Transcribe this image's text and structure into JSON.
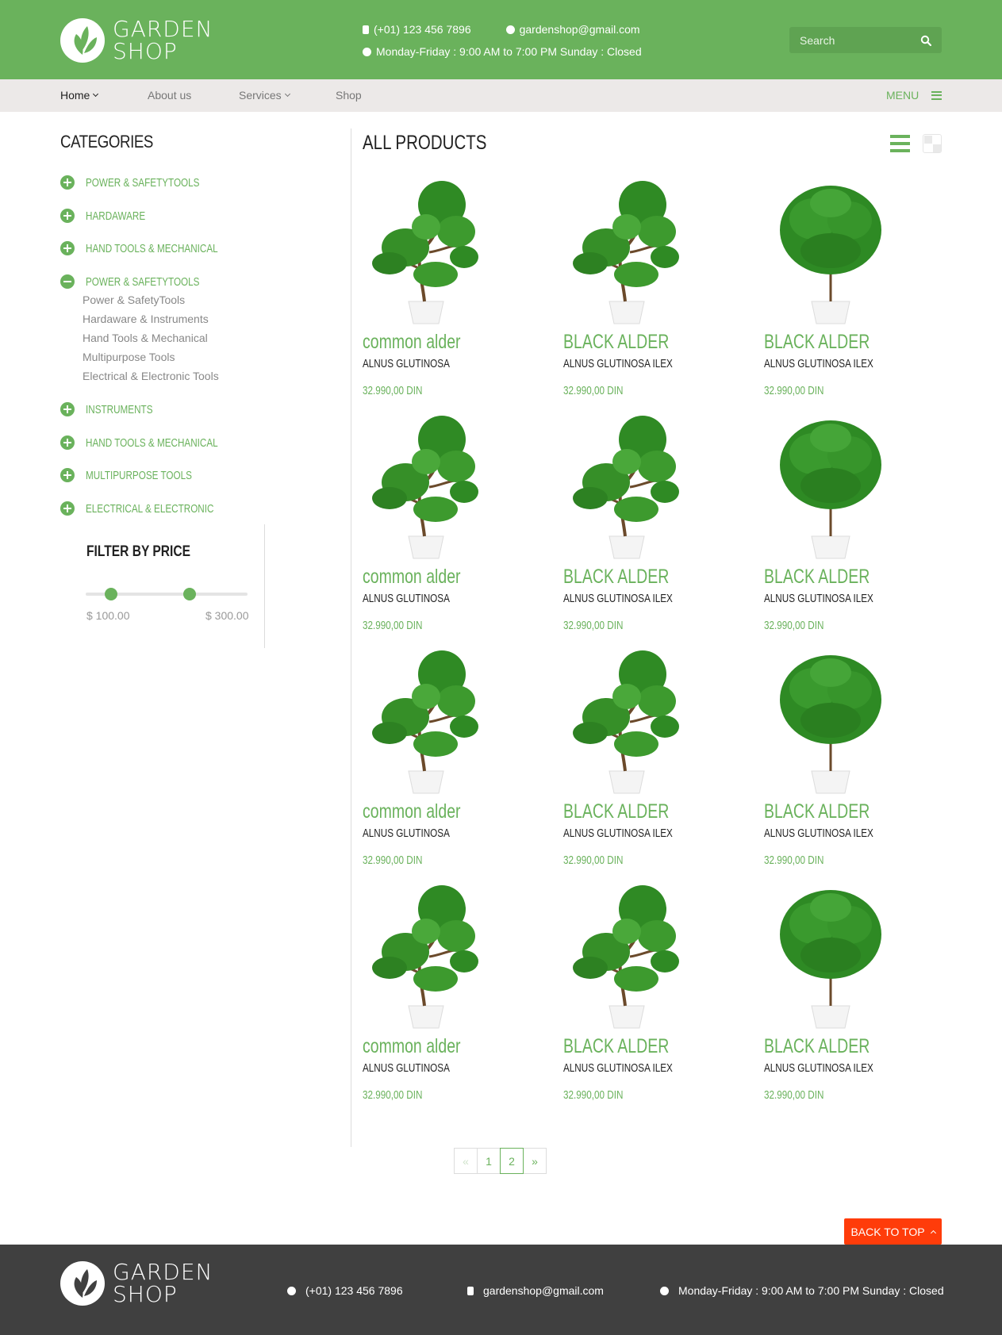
{
  "header": {
    "logo_line1": "GARDEN",
    "logo_line2": "SHOP",
    "phone": "(+01) 123 456 7896",
    "email": "gardenshop@gmail.com",
    "hours": "Monday-Friday : 9:00 AM to 7:00 PM Sunday : Closed",
    "search_placeholder": "Search"
  },
  "nav": {
    "items": [
      {
        "label": "Home"
      },
      {
        "label": "About us"
      },
      {
        "label": "Services"
      },
      {
        "label": "Shop"
      }
    ],
    "menu_label": "MENU"
  },
  "sidebar": {
    "title": "CATEGORIES",
    "categories": [
      {
        "label": "POWER & SAFETYTOOLS",
        "expanded": false
      },
      {
        "label": "HARDAWARE",
        "expanded": false
      },
      {
        "label": "HAND TOOLS & MECHANICAL",
        "expanded": false
      },
      {
        "label": "POWER & SAFETYTOOLS",
        "expanded": true
      },
      {
        "label": "INSTRUMENTS",
        "expanded": false
      },
      {
        "label": "HAND TOOLS & MECHANICAL",
        "expanded": false
      },
      {
        "label": "MULTIPURPOSE TOOLS",
        "expanded": false
      },
      {
        "label": "ELECTRICAL & ELECTRONIC",
        "expanded": false
      }
    ],
    "subcategories": [
      "Power & SafetyTools",
      "Hardaware & Instruments",
      "Hand Tools & Mechanical",
      "Multipurpose Tools",
      "Electrical & Electronic Tools"
    ],
    "filter": {
      "title": "FILTER BY PRICE",
      "min_label": "$ 100.00",
      "max_label": "$ 300.00"
    }
  },
  "main": {
    "title": "ALL PRODUCTS",
    "products": [
      {
        "name": "common alder",
        "sub": "ALNUS GLUTINOSA",
        "price": "32.990,00 DIN",
        "plant": "pine"
      },
      {
        "name": "BLACK ALDER",
        "sub": "ALNUS GLUTINOSA ILEX",
        "price": "32.990,00 DIN",
        "plant": "pine"
      },
      {
        "name": "BLACK ALDER",
        "sub": "ALNUS GLUTINOSA ILEX",
        "price": "32.990,00 DIN",
        "plant": "bush"
      },
      {
        "name": "common alder",
        "sub": "ALNUS GLUTINOSA",
        "price": "32.990,00 DIN",
        "plant": "pine"
      },
      {
        "name": "BLACK ALDER",
        "sub": "ALNUS GLUTINOSA ILEX",
        "price": "32.990,00 DIN",
        "plant": "pine"
      },
      {
        "name": "BLACK ALDER",
        "sub": "ALNUS GLUTINOSA ILEX",
        "price": "32.990,00 DIN",
        "plant": "bush"
      },
      {
        "name": "common alder",
        "sub": "ALNUS GLUTINOSA",
        "price": "32.990,00 DIN",
        "plant": "pine"
      },
      {
        "name": "BLACK ALDER",
        "sub": "ALNUS GLUTINOSA ILEX",
        "price": "32.990,00 DIN",
        "plant": "pine"
      },
      {
        "name": "BLACK ALDER",
        "sub": "ALNUS GLUTINOSA ILEX",
        "price": "32.990,00 DIN",
        "plant": "bush"
      },
      {
        "name": "common alder",
        "sub": "ALNUS GLUTINOSA",
        "price": "32.990,00 DIN",
        "plant": "pine"
      },
      {
        "name": "BLACK ALDER",
        "sub": "ALNUS GLUTINOSA ILEX",
        "price": "32.990,00 DIN",
        "plant": "pine"
      },
      {
        "name": "BLACK ALDER",
        "sub": "ALNUS GLUTINOSA ILEX",
        "price": "32.990,00 DIN",
        "plant": "bush"
      }
    ]
  },
  "pagination": {
    "prev": "«",
    "pages": [
      "1",
      "2"
    ],
    "current": "2",
    "next": "»"
  },
  "back_to_top": "BACK TO TOP",
  "footer": {
    "logo_line1": "GARDEN",
    "logo_line2": "SHOP",
    "phone": "(+01) 123 456 7896",
    "email": "gardenshop@gmail.com",
    "hours": "Monday-Friday : 9:00 AM to 7:00 PM Sunday : Closed"
  },
  "colors": {
    "brand_green": "#6ab25c",
    "nav_bg": "#ece9e8",
    "footer_bg": "#404040",
    "back_to_top": "#ff3c0a"
  }
}
